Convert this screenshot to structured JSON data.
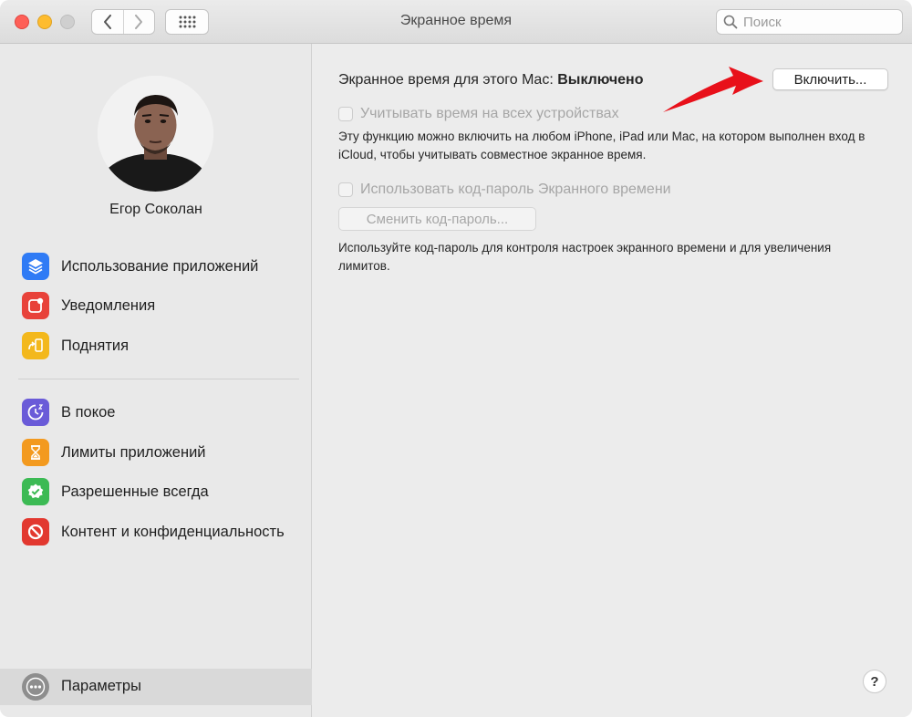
{
  "window": {
    "title": "Экранное время"
  },
  "search": {
    "placeholder": "Поиск"
  },
  "user": {
    "name": "Егор Соколан"
  },
  "sidebar": {
    "group1": [
      {
        "label": "Использование приложений",
        "icon": "layers-icon",
        "color": "#2f7bf5"
      },
      {
        "label": "Уведомления",
        "icon": "notification-icon",
        "color": "#e8423a"
      },
      {
        "label": "Поднятия",
        "icon": "pickup-icon",
        "color": "#f3b81c"
      }
    ],
    "group2": [
      {
        "label": "В покое",
        "icon": "downtime-icon",
        "color": "#6a5bd8"
      },
      {
        "label": "Лимиты приложений",
        "icon": "hourglass-icon",
        "color": "#f39a1f"
      },
      {
        "label": "Разрешенные всегда",
        "icon": "checkmark-badge-icon",
        "color": "#3cba54"
      },
      {
        "label": "Контент и конфиденциальность",
        "icon": "restriction-icon",
        "color": "#e2382f"
      }
    ],
    "params": {
      "label": "Параметры",
      "icon": "more-icon"
    }
  },
  "main": {
    "status_label": "Экранное время для этого Mac:",
    "status_value": "Выключено",
    "enable_button": "Включить...",
    "share_checkbox": "Учитывать время на всех устройствах",
    "share_desc": "Эту функцию можно включить на любом iPhone, iPad или Mac, на котором выполнен вход в iCloud, чтобы учитывать совместное экранное время.",
    "passcode_checkbox": "Использовать код-пароль Экранного времени",
    "change_passcode_button": "Сменить код-пароль...",
    "passcode_desc": "Используйте код-пароль для контроля настроек экранного времени и для увеличения лимитов.",
    "help_button": "?"
  },
  "colors": {
    "annotation_arrow": "#e8101a"
  }
}
